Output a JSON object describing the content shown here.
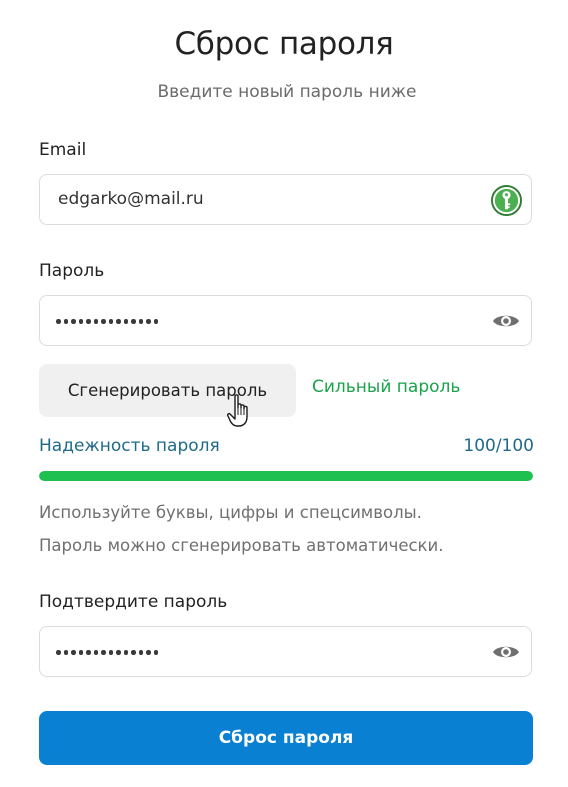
{
  "header": {
    "title": "Сброс пароля",
    "subtitle": "Введите новый пароль ниже"
  },
  "email": {
    "label": "Email",
    "value": "edgarko@mail.ru",
    "icon": "password-manager-key-icon"
  },
  "password": {
    "label": "Пароль",
    "masked_length": 14,
    "icon": "eye-icon"
  },
  "generator": {
    "button_label": "Сгенерировать пароль",
    "strength_label": "Сильный пароль"
  },
  "reliability": {
    "label": "Надежность пароля",
    "score_text": "100/100",
    "fraction": 1.0
  },
  "hints": {
    "line1": "Используйте буквы, цифры и спецсимволы.",
    "line2": "Пароль можно сгенерировать автоматически."
  },
  "confirm": {
    "label": "Подтвердите пароль",
    "masked_length": 14,
    "icon": "eye-icon"
  },
  "submit": {
    "label": "Сброс пароля"
  },
  "colors": {
    "accent": "#0a80d2",
    "strength_green": "#1aa34a",
    "progress_green": "#1ec14f",
    "reliability_text": "#1f6a8a"
  }
}
